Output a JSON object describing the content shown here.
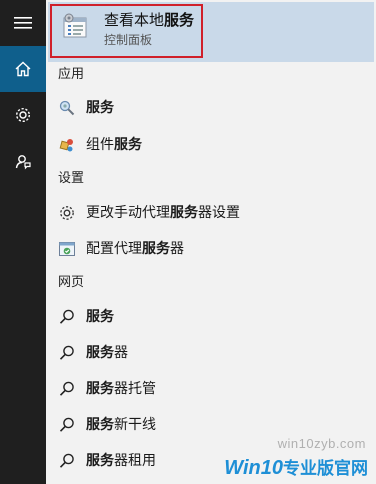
{
  "rail": {
    "items": [
      {
        "icon": "hamburger-menu-icon"
      },
      {
        "icon": "home-icon"
      },
      {
        "icon": "gear-icon"
      },
      {
        "icon": "feedback-icon"
      }
    ]
  },
  "top_result": {
    "title_plain": "查看本地",
    "title_bold": "服务",
    "subtitle": "控制面板",
    "icon": "services-window-icon"
  },
  "sections": {
    "apps": "应用",
    "settings": "设置",
    "web": "网页"
  },
  "apps": [
    {
      "prefix": "",
      "bold": "服务",
      "suffix": "",
      "icon": "magnifier-gear-icon"
    },
    {
      "prefix": "组件",
      "bold": "服务",
      "suffix": "",
      "icon": "component-services-icon"
    }
  ],
  "settings": [
    {
      "prefix": "更改手动代理",
      "bold": "服务",
      "suffix": "器设置",
      "icon": "gear-icon"
    },
    {
      "prefix": "配置代理",
      "bold": "服务",
      "suffix": "器",
      "icon": "proxy-config-icon"
    }
  ],
  "web": [
    {
      "prefix": "",
      "bold": "服务",
      "suffix": "",
      "icon": "search-icon"
    },
    {
      "prefix": "",
      "bold": "服务",
      "suffix": "器",
      "icon": "search-icon"
    },
    {
      "prefix": "",
      "bold": "服务",
      "suffix": "器托管",
      "icon": "search-icon"
    },
    {
      "prefix": "",
      "bold": "服务",
      "suffix": "新干线",
      "icon": "search-icon"
    },
    {
      "prefix": "",
      "bold": "服务",
      "suffix": "器租用",
      "icon": "search-icon"
    }
  ],
  "watermark": {
    "url": "win10zyb.com",
    "brand": "Win10",
    "brand_cn": "专业版官网"
  },
  "colors": {
    "rail_bg": "#1f1f1f",
    "rail_active": "#0f5f8c",
    "selected_bg": "#c9d9e9",
    "highlight_border": "#d0202a",
    "brand_blue": "#1e8fd6"
  }
}
